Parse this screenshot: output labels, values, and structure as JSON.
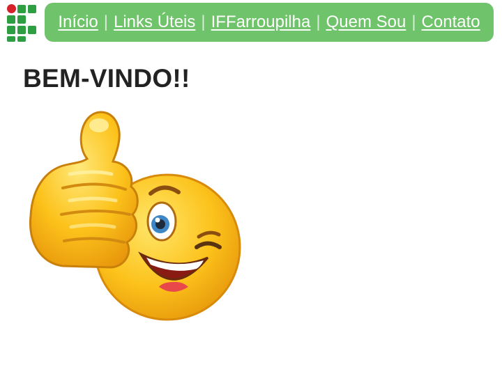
{
  "header": {
    "logo_icon": "iffarroupilha-logo-icon",
    "colors": {
      "nav_background": "#6fc36a",
      "logo_green": "#2e9e43",
      "logo_red": "#d6202a"
    },
    "nav": [
      {
        "label": "Início"
      },
      {
        "label": "Links Úteis"
      },
      {
        "label": "IFFarroupilha"
      },
      {
        "label": "Quem Sou"
      },
      {
        "label": "Contato"
      }
    ],
    "separator": "|"
  },
  "main": {
    "title": "BEM-VINDO!!",
    "image": {
      "icon": "thumbs-up-wink-emoji-icon"
    }
  }
}
